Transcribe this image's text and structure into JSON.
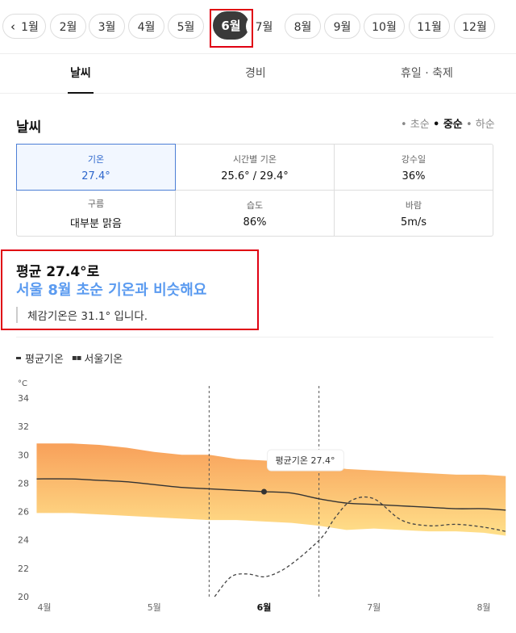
{
  "months": {
    "prev_icon": "chevron-left-icon",
    "items": [
      "1월",
      "2월",
      "3월",
      "4월",
      "5월",
      "6월",
      "7월",
      "8월",
      "9월",
      "10월",
      "11월",
      "12월"
    ],
    "selected": "6월"
  },
  "tabs": [
    {
      "label": "날씨",
      "active": true
    },
    {
      "label": "경비",
      "active": false
    },
    {
      "label": "휴일 · 축제",
      "active": false
    }
  ],
  "weather": {
    "title": "날씨",
    "seasons": [
      "• 초순",
      "• 중순",
      "• 하순"
    ],
    "selected_season": "• 중순",
    "stats": [
      {
        "label": "기온",
        "value": "27.4°"
      },
      {
        "label": "시간별 기온",
        "value": "25.6° / 29.4°"
      },
      {
        "label": "강수일",
        "value": "36%"
      },
      {
        "label": "구름",
        "value": "대부분 맑음"
      },
      {
        "label": "습도",
        "value": "86%"
      },
      {
        "label": "바람",
        "value": "5m/s"
      }
    ]
  },
  "summary": {
    "line1": "평균 27.4°로",
    "line2": "서울 8월 초순 기온과 비슷해요",
    "line3": "체감기온은 31.1° 입니다."
  },
  "legend": {
    "avg": "평균기온",
    "seoul": "서울기온"
  },
  "chart_data": {
    "type": "line",
    "unit": "°C",
    "ylim": [
      20,
      34
    ],
    "yticks": [
      20,
      22,
      24,
      26,
      28,
      30,
      32,
      34
    ],
    "x_labels": [
      "4월",
      "5월",
      "6월",
      "7월",
      "8월"
    ],
    "x_bold": "6월",
    "tooltip": "평균기온 27.4°",
    "highlight_point": {
      "x": 2.0,
      "y": 27.4
    },
    "series": [
      {
        "name": "평균기온",
        "x": [
          -0.07,
          0.25,
          0.5,
          0.75,
          1.0,
          1.25,
          1.5,
          1.75,
          2.0,
          2.25,
          2.5,
          2.75,
          3.0,
          3.25,
          3.5,
          3.75,
          4.0,
          4.2
        ],
        "y": [
          28.3,
          28.3,
          28.2,
          28.1,
          27.9,
          27.7,
          27.6,
          27.5,
          27.4,
          27.3,
          26.9,
          26.6,
          26.5,
          26.4,
          26.3,
          26.2,
          26.2,
          26.1
        ]
      },
      {
        "name": "서울기온",
        "x": [
          1.55,
          1.7,
          1.85,
          2.0,
          2.15,
          2.3,
          2.45,
          2.55,
          2.65,
          2.8,
          3.0,
          3.25,
          3.5,
          3.75,
          4.0,
          4.2
        ],
        "y": [
          20.0,
          21.4,
          21.6,
          21.4,
          21.8,
          22.6,
          23.6,
          24.4,
          25.6,
          26.8,
          26.9,
          25.4,
          25.0,
          25.1,
          24.9,
          24.6
        ]
      }
    ],
    "band": {
      "x": [
        -0.07,
        0.25,
        0.5,
        0.75,
        1.0,
        1.25,
        1.5,
        1.75,
        2.0,
        2.25,
        2.5,
        2.75,
        3.0,
        3.25,
        3.5,
        3.75,
        4.0,
        4.2
      ],
      "high": [
        30.8,
        30.8,
        30.7,
        30.5,
        30.2,
        30.0,
        30.0,
        29.7,
        29.6,
        29.5,
        29.3,
        29.0,
        28.9,
        28.8,
        28.7,
        28.6,
        28.6,
        28.5
      ],
      "low": [
        25.9,
        25.9,
        25.8,
        25.7,
        25.6,
        25.5,
        25.4,
        25.4,
        25.3,
        25.2,
        25.0,
        24.7,
        24.8,
        24.7,
        24.6,
        24.6,
        24.5,
        24.3
      ]
    },
    "dashed_vlines": [
      1.5,
      2.5
    ],
    "grid": false
  },
  "colors": {
    "accent": "#2d66cc",
    "highlight": "#5b9bf0",
    "band_top": "#f8a05a",
    "band_bottom": "#ffe08a"
  }
}
